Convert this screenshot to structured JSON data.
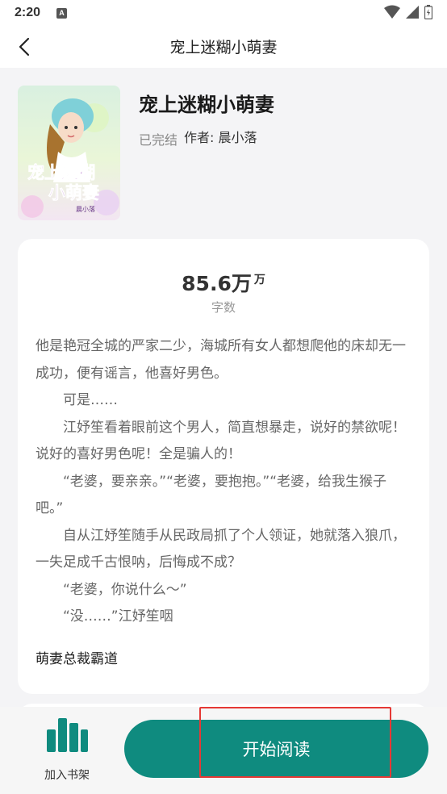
{
  "status_bar": {
    "time": "2:20",
    "notification_badge": "A"
  },
  "app_bar": {
    "title": "宠上迷糊小萌妻"
  },
  "book": {
    "title": "宠上迷糊小萌妻",
    "status": "已完结",
    "author": "作者: 晨小落",
    "cover_title_line1": "宠上迷糊",
    "cover_title_line2": "小萌妻",
    "cover_author": "晨小落"
  },
  "stats": {
    "word_count": "85.6万",
    "word_unit": "万",
    "word_label": "字数"
  },
  "synopsis": [
    "他是艳冠全城的严家二少，海城所有女人都想爬他的床却无一成功，便有谣言，他喜好男色。",
    "　　可是……",
    "　　江妤笙看着眼前这个男人，简直想暴走，说好的禁欲呢！说好的喜好男色呢！全是骗人的！",
    "　　“老婆，要亲亲。”“老婆，要抱抱。”“老婆，给我生猴子吧。”",
    "　　自从江妤笙随手从民政局抓了个人领证，她就落入狼爪，一失足成千古恨呐，后悔成不成？",
    "　　“老婆，你说什么～”",
    "　　“没……”江妤笙咽"
  ],
  "tag": "萌妻总裁霸道",
  "bottom_bar": {
    "shelf_label": "加入书架",
    "read_label": "开始阅读"
  },
  "colors": {
    "accent": "#0f8b7f",
    "highlight": "#e53935"
  }
}
